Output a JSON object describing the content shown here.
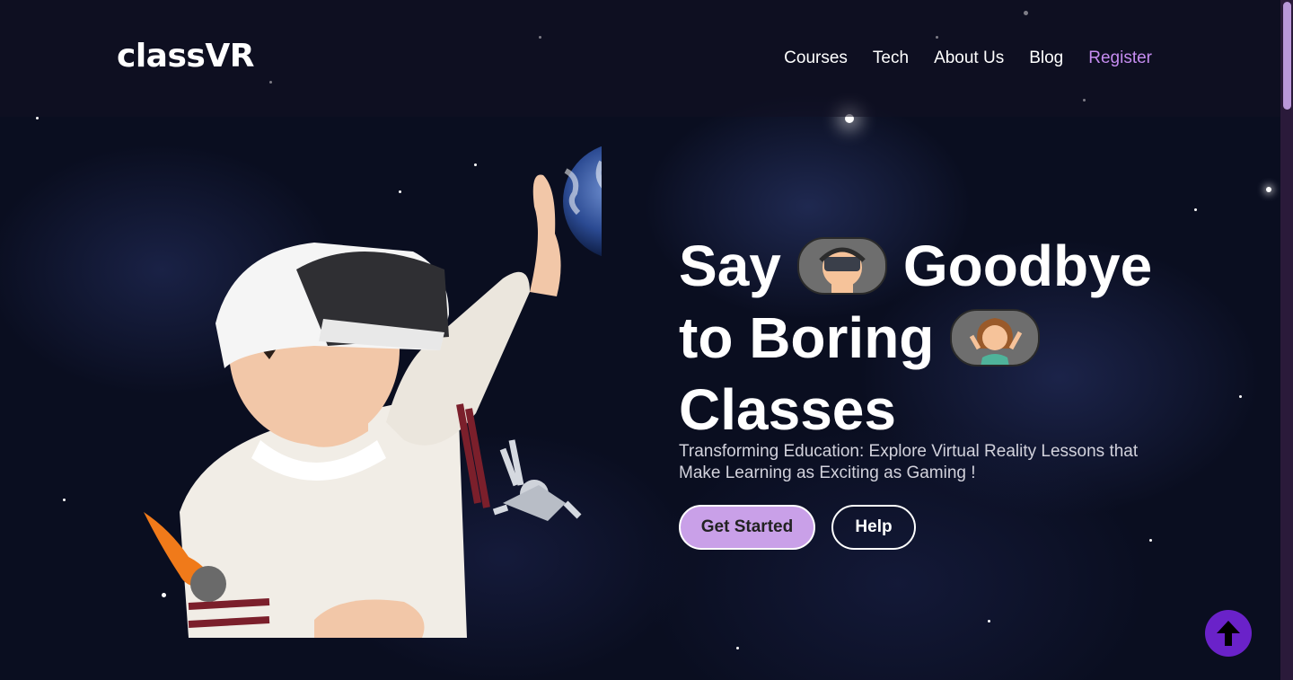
{
  "header": {
    "logo": "classVR",
    "nav": [
      "Courses",
      "Tech",
      "About Us",
      "Blog",
      "Register"
    ]
  },
  "hero": {
    "title_line1_a": "Say",
    "title_line1_b": "Goodbye",
    "title_line2": "to Boring",
    "title_line3": "Classes",
    "subtitle": "Transforming Education: Explore Virtual Reality Lessons that Make Learning as Exciting as Gaming !",
    "primary_button": "Get Started",
    "secondary_button": "Help"
  },
  "icons": {
    "pill1": "vr-headset-avatar-icon",
    "pill2": "cheering-girl-avatar-icon",
    "fab": "arrow-up-icon"
  },
  "colors": {
    "accent": "#c9a0e8",
    "register": "#c58cf0",
    "fab": "#6a22c9"
  }
}
